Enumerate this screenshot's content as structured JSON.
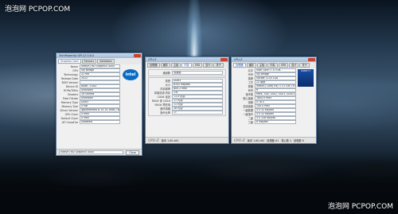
{
  "watermarks": {
    "top_left": "泡泡网 PCPOP.COM",
    "bottom_right": "泡泡网 PCPOP.COM"
  },
  "gpuz": {
    "title": "TechPowerUp GPU-Z 0.6.0",
    "tabs": [
      "Graphics Card",
      "Sensors",
      "Validation"
    ],
    "rows": [
      {
        "label": "Name",
        "value": "Intel(R) HD Graphics 4000"
      },
      {
        "label": "GPU",
        "value": "Ivy Bridge"
      },
      {
        "label": "Technology",
        "value": "22 nm"
      },
      {
        "label": "Release Date",
        "value": "2012"
      },
      {
        "label": "BIOS Version",
        "value": ""
      },
      {
        "label": "Device ID",
        "value": "8086 - 0162"
      },
      {
        "label": "ROPs/TMUs",
        "value": "Unknown"
      },
      {
        "label": "Shaders",
        "value": "16 Unified"
      },
      {
        "label": "Pixel Fillrate",
        "value": "Unknown"
      },
      {
        "label": "Memory Type",
        "value": "DDR3"
      },
      {
        "label": "Memory Size",
        "value": "0 MB"
      },
      {
        "label": "Driver Version",
        "value": "igdumdim64 8.15.10.2696 / Win7 64"
      },
      {
        "label": "GPU Clock",
        "value": "0 MHz"
      },
      {
        "label": "Default Clock",
        "value": "0 MHz"
      },
      {
        "label": "ATI CrossFire",
        "value": "Disabled"
      }
    ],
    "select_value": "Intel(R) HD Graphics 4000",
    "close_label": "Close",
    "intel_logo": "intel"
  },
  "cpuz_mem": {
    "title": "CPU-Z",
    "tabs": [
      "处理器",
      "缓存",
      "主板",
      "内存",
      "SPD",
      "显卡",
      "关于"
    ],
    "rows": [
      {
        "label": "类型",
        "value": "DDR3"
      },
      {
        "label": "大小",
        "value": "8192 MBytes"
      },
      {
        "label": "内存频率",
        "value": "800.2 MHz"
      },
      {
        "label": "前端总线:内存",
        "value": "1:6"
      },
      {
        "label": "CAS# 延迟",
        "value": "11.0 时钟"
      },
      {
        "label": "RAS# 到 CAS#",
        "value": "11 时钟"
      },
      {
        "label": "RAS# 预充电",
        "value": "11 时钟"
      },
      {
        "label": "循环周期",
        "value": "28 时钟"
      },
      {
        "label": "指令比率",
        "value": "1T"
      }
    ],
    "channels": "双通道",
    "version": "版本 1.60.x64",
    "brand": "CPU-Z"
  },
  "cpuz_cpu": {
    "title": "CPU-Z",
    "tabs": [
      "处理器",
      "缓存",
      "主板",
      "内存",
      "SPD",
      "显卡",
      "关于"
    ],
    "rows": [
      {
        "label": "名字",
        "value": "Intel Core i7 3770K"
      },
      {
        "label": "代号",
        "value": "Ivy Bridge"
      },
      {
        "label": "插槽",
        "value": "Socket 1155 LGA"
      },
      {
        "label": "工艺",
        "value": "22 纳米"
      },
      {
        "label": "规格",
        "value": "Intel(R) Core(TM) i7-3770K CPU @ 3.50GHz"
      },
      {
        "label": "系列",
        "value": "6"
      },
      {
        "label": "指令集",
        "value": "MMX, SSE, SSE2, SSE3, SSSE3, SSE4.1, SSE4.2, EM64T, VT-x, AES, AVX"
      },
      {
        "label": "核心速度",
        "value": "1600.0 MHz"
      },
      {
        "label": "倍频",
        "value": "x 16.0"
      },
      {
        "label": "总线速度",
        "value": "100.0 MHz"
      },
      {
        "label": "一级数据",
        "value": "4 x 32 KBytes"
      },
      {
        "label": "一级指令",
        "value": "4 x 32 KBytes"
      },
      {
        "label": "二级",
        "value": "4 x 256 KBytes"
      },
      {
        "label": "三级",
        "value": "8 MBytes"
      }
    ],
    "selection": "处理器 #1",
    "cores": "核心数 4",
    "threads": "线程数 8",
    "version": "版本 1.60.x64",
    "brand": "CPU-Z",
    "badge": "CORE i7"
  }
}
